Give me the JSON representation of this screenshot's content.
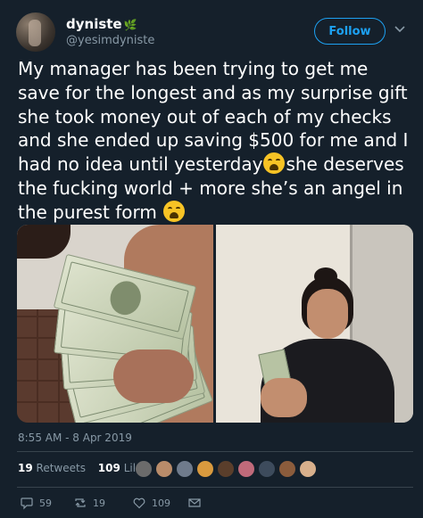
{
  "user": {
    "display_name": "dyniste",
    "name_decoration": "🌿",
    "handle": "@yesimdyniste",
    "avatar": "profile-photo"
  },
  "follow_label": "Follow",
  "tweet": {
    "text_before_emoji1": "My manager has been trying to get me save for the longest and as my surprise gift she took money out of each of my checks and she ended up saving $500 for me and I had no idea until yesterday",
    "text_after_emoji1": "she deserves the fucking world + more she’s an angel in the purest form",
    "emoji": "weary-face"
  },
  "media": [
    {
      "name": "money-photo"
    },
    {
      "name": "manager-photo"
    }
  ],
  "timestamp": "8:55 AM - 8 Apr 2019",
  "stats": {
    "retweets_count": "19",
    "retweets_label": "Retweets",
    "likes_count": "109",
    "likes_label": "Likes"
  },
  "likers": [
    "#6b6b6b",
    "#b98c6a",
    "#6f7b8c",
    "#d99a3e",
    "#5a3e2b",
    "#c06a7a",
    "#3d4b5c",
    "#8b5c3c",
    "#d8b08c"
  ],
  "actions": {
    "reply_count": "59",
    "retweet_count": "19",
    "like_count": "109"
  },
  "colors": {
    "background": "#15202b",
    "accent": "#1da1f2",
    "muted": "#8899a6",
    "divider": "#38444d"
  }
}
